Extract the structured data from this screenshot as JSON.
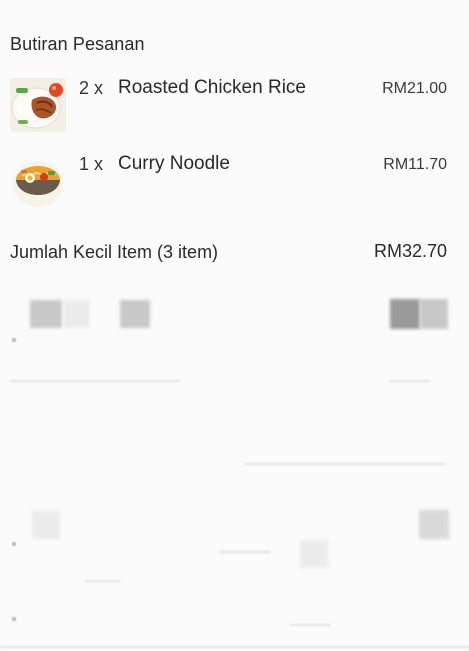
{
  "order_details": {
    "title": "Butiran Pesanan",
    "items": [
      {
        "quantity": "2 x",
        "name": "Roasted Chicken Rice",
        "price": "RM21.00",
        "thumbnail_icon": "chicken-rice-plate-icon"
      },
      {
        "quantity": "1 x",
        "name": "Curry Noodle",
        "price": "RM11.70",
        "thumbnail_icon": "curry-noodle-bowl-icon"
      }
    ],
    "subtotal_label": "Jumlah Kecil Item (3 item)",
    "subtotal_value": "RM32.70"
  }
}
